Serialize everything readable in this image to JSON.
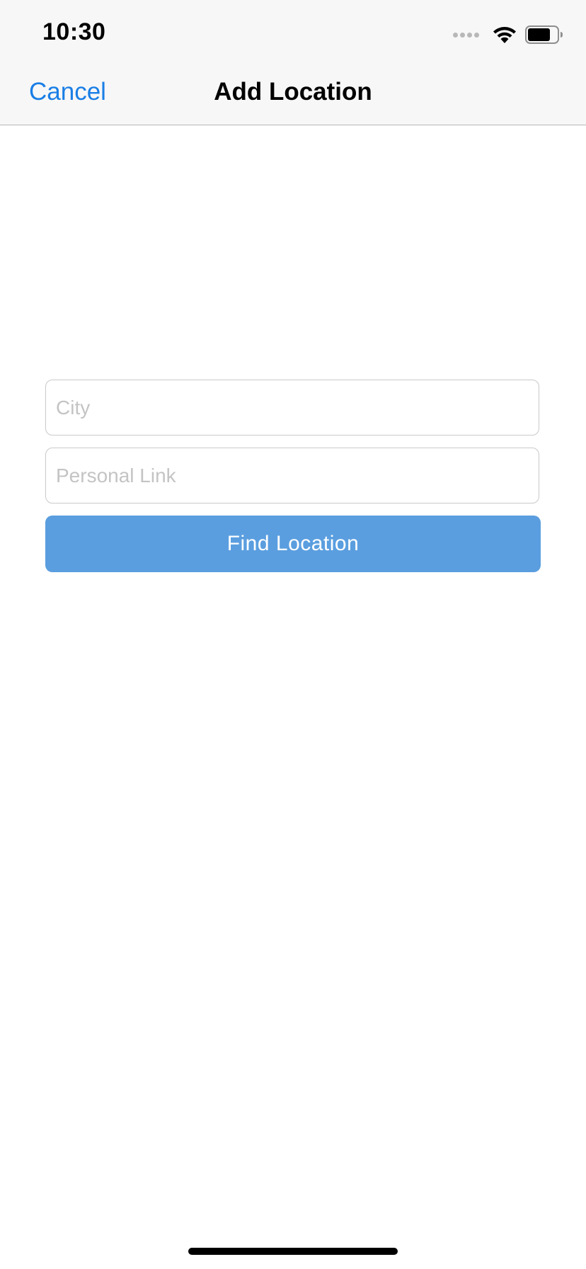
{
  "status_bar": {
    "time": "10:30",
    "icons": [
      "signal-dots-icon",
      "wifi-icon",
      "battery-icon"
    ]
  },
  "nav": {
    "cancel_label": "Cancel",
    "title": "Add Location"
  },
  "form": {
    "city": {
      "placeholder": "City",
      "value": ""
    },
    "link": {
      "placeholder": "Personal Link",
      "value": ""
    },
    "find_label": "Find Location"
  },
  "colors": {
    "accent": "#1a7ee6",
    "button": "#5a9edf",
    "nav_background": "#f7f7f7",
    "placeholder": "#c4c4c4"
  }
}
